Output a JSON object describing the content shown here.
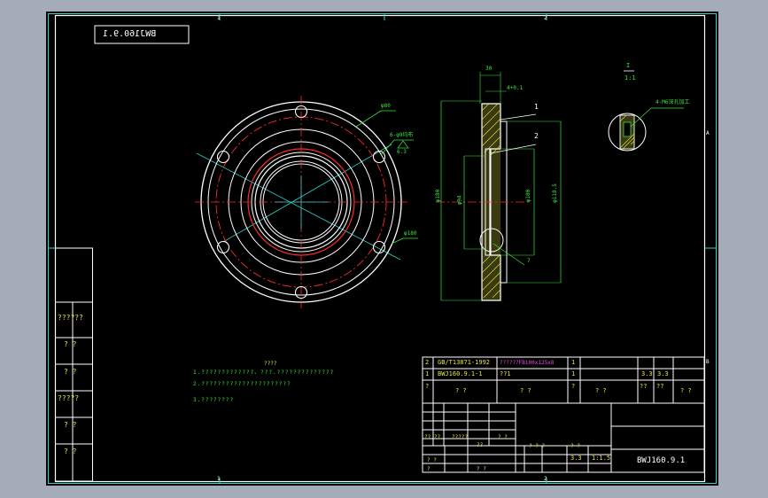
{
  "drawing": {
    "code_box_text": "BWJ160.9.1",
    "zone_labels": {
      "top_a": "1",
      "top_b": "2",
      "bottom_a": "1",
      "bottom_b": "2",
      "right_a": "A",
      "right_b": "B"
    },
    "detail_view": {
      "label_top": "I",
      "label_scale": "1:1",
      "callout": "4-M6深孔加工"
    },
    "front_view_labels": {
      "bolt_circle": "φ80",
      "hole_callout": "6-φ9均布",
      "hole_note": "6.3",
      "outer_dia": "φ180"
    },
    "section_view_labels": {
      "dim_top": "30",
      "dim_top2": "4+0.1",
      "balloon_1": "1",
      "balloon_2": "2",
      "dim_left_outer": "φ180",
      "dim_left_inner": "φ94",
      "dim_right_1": "φ100",
      "dim_right_2": "φ118.5",
      "dim_bottom": "7"
    },
    "notes": {
      "title": "????",
      "line1": "1.?????????????、???.??????????????",
      "line2": "2.??????????????????????",
      "line3": "3.????????"
    },
    "left_strip": [
      "??????",
      "? ?",
      "? ?",
      "?????",
      "? ?",
      "? ?"
    ],
    "bom": [
      {
        "no": "2",
        "code": "GB/T13871-1992",
        "name": "??????FB100x125x8",
        "qty": "1",
        "material": "",
        "c1": "",
        "c2": "",
        "note": ""
      },
      {
        "no": "1",
        "code": "BWJ160.9.1-1",
        "name": "??1",
        "qty": "1",
        "material": "",
        "c1": "3.3",
        "c2": "3.3",
        "note": ""
      }
    ],
    "bom_header": [
      "?",
      "? ?",
      "? ?",
      "?",
      "? ?",
      "??",
      "??",
      "? ?"
    ],
    "title_block": {
      "drawing_no": "BWJ160.9.1",
      "labels": [
        "?? ??",
        "?????",
        "? ?",
        "? ?",
        "??",
        "?",
        "? ?",
        "? ? ?",
        "? ?"
      ],
      "weight": "3.3",
      "scale": "1:1.5"
    }
  },
  "colors": {
    "frame": "#2fd3ce",
    "geometry": "#ffffff",
    "dimension": "#37e63c",
    "centerline": "#ff2a2a",
    "hatch": "#e5e537",
    "text_magenta": "#e84be8"
  }
}
